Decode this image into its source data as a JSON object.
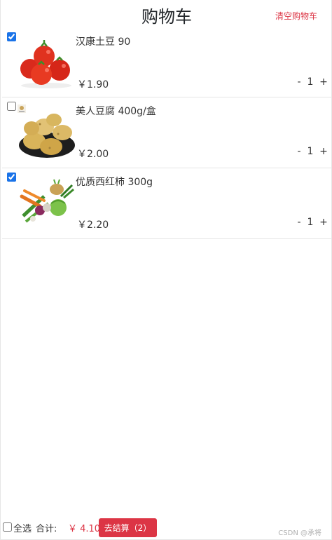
{
  "header": {
    "title": "购物车",
    "clear_label": "清空购物车"
  },
  "items": [
    {
      "name": "汉康土豆 90",
      "price": "￥1.90",
      "qty": "1",
      "checked": true,
      "image_icon": "tomato-image"
    },
    {
      "name": "美人豆腐 400g/盒",
      "price": "￥2.00",
      "qty": "1",
      "checked": false,
      "image_icon": "potato-image"
    },
    {
      "name": "优质西红柿 300g",
      "price": "￥2.20",
      "qty": "1",
      "checked": true,
      "image_icon": "vegetables-image"
    }
  ],
  "controls": {
    "minus": "-",
    "plus": "+"
  },
  "footer": {
    "select_all_label": "全选",
    "total_label": "合计:",
    "total_value": "￥ 4.10",
    "checkout_label": "去结算（2）"
  },
  "watermark": "CSDN @承将",
  "colors": {
    "accent": "#dc3545",
    "divider": "#e6e6e6"
  }
}
